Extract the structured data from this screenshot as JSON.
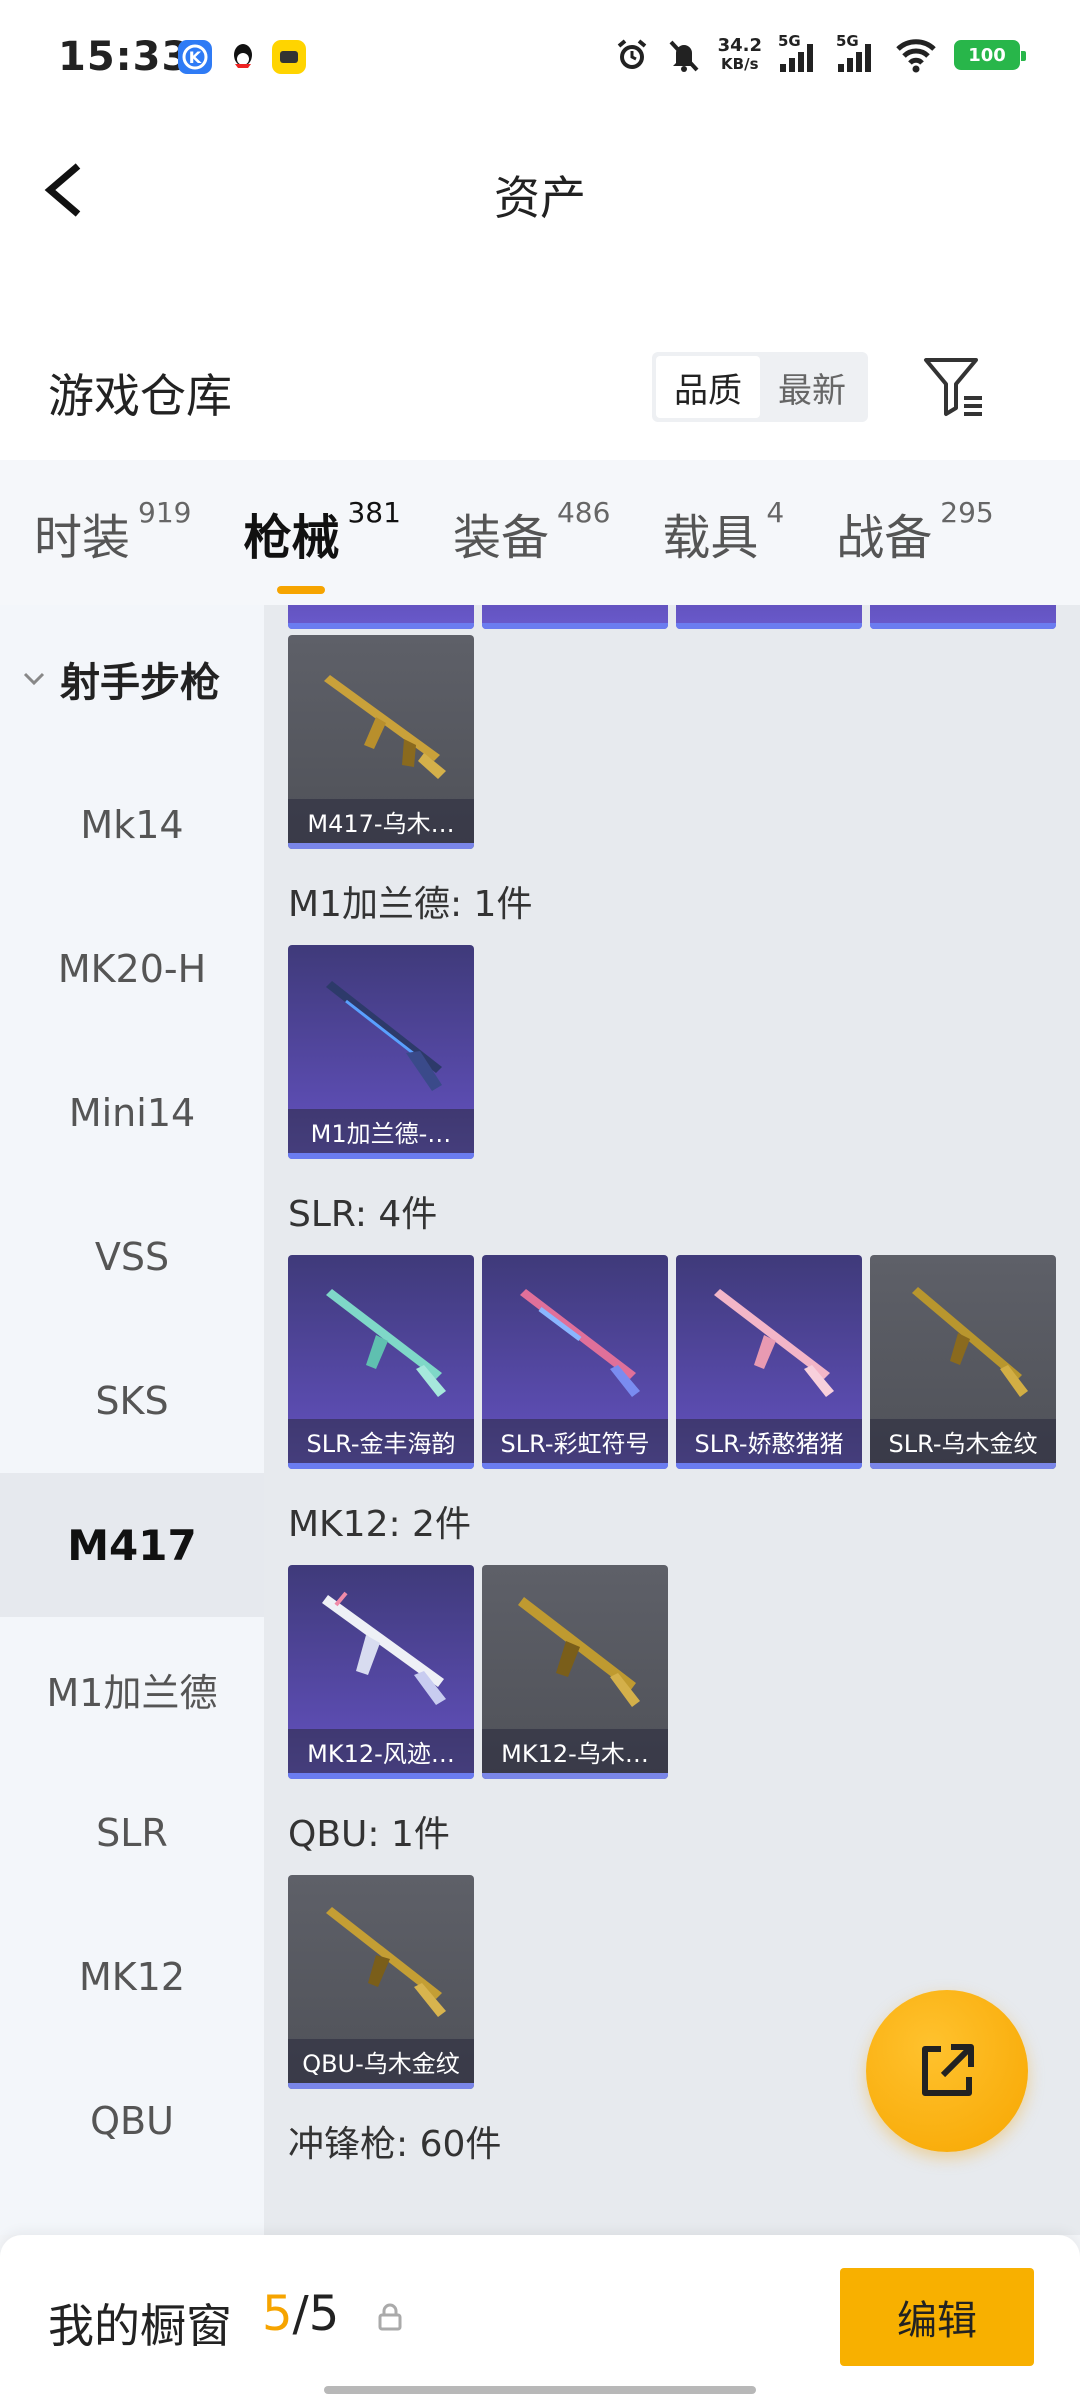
{
  "status_bar": {
    "time": "15:33",
    "net_speed_value": "34.2",
    "net_speed_unit": "KB/s",
    "signal1_label": "5G",
    "signal2_label": "5G",
    "battery": "100",
    "icons": [
      "app-k-icon",
      "qq-icon",
      "app-yellow-icon",
      "alarm-icon",
      "mute-icon",
      "wifi-icon"
    ]
  },
  "header": {
    "title": "资产",
    "back_icon": "chevron-left-icon"
  },
  "warehouse": {
    "title": "游戏仓库",
    "sort_options": [
      "品质",
      "最新"
    ],
    "sort_selected": "品质",
    "filter_icon": "filter-icon"
  },
  "tabs": [
    {
      "label": "时装",
      "count": "919"
    },
    {
      "label": "枪械",
      "count": "381",
      "active": true
    },
    {
      "label": "装备",
      "count": "486"
    },
    {
      "label": "载具",
      "count": "4"
    },
    {
      "label": "战备",
      "count": "295"
    }
  ],
  "sidebar": {
    "group": "射手步枪",
    "items": [
      "Mk14",
      "MK20-H",
      "Mini14",
      "VSS",
      "SKS",
      "M417",
      "M1加兰德",
      "SLR",
      "MK12",
      "QBU"
    ],
    "selected": "M417"
  },
  "main": {
    "sections": [
      {
        "title": "",
        "cards": [
          {
            "label": "M417-乌木…",
            "style": "gray"
          }
        ]
      },
      {
        "title": "M1加兰德: 1件",
        "cards": [
          {
            "label": "M1加兰德-…",
            "style": "purple"
          }
        ]
      },
      {
        "title": "SLR: 4件",
        "cards": [
          {
            "label": "SLR-金丰海韵",
            "style": "purple"
          },
          {
            "label": "SLR-彩虹符号",
            "style": "purple"
          },
          {
            "label": "SLR-娇憨猪猪",
            "style": "purple"
          },
          {
            "label": "SLR-乌木金纹",
            "style": "gray"
          }
        ]
      },
      {
        "title": "MK12: 2件",
        "cards": [
          {
            "label": "MK12-风迹…",
            "style": "purple"
          },
          {
            "label": "MK12-乌木…",
            "style": "gray"
          }
        ]
      },
      {
        "title": "QBU: 1件",
        "cards": [
          {
            "label": "QBU-乌木金纹",
            "style": "gray"
          }
        ]
      },
      {
        "title": "冲锋枪: 60件",
        "cards": []
      }
    ]
  },
  "fab": {
    "icon": "share-external-icon"
  },
  "bottom": {
    "showcase_label": "我的橱窗",
    "showcase_current": "5",
    "showcase_total": "5",
    "edit_label": "编辑"
  },
  "colors": {
    "accent": "#f6a400",
    "purple_card": "#5b4cb0",
    "gray_card": "#56585f"
  }
}
